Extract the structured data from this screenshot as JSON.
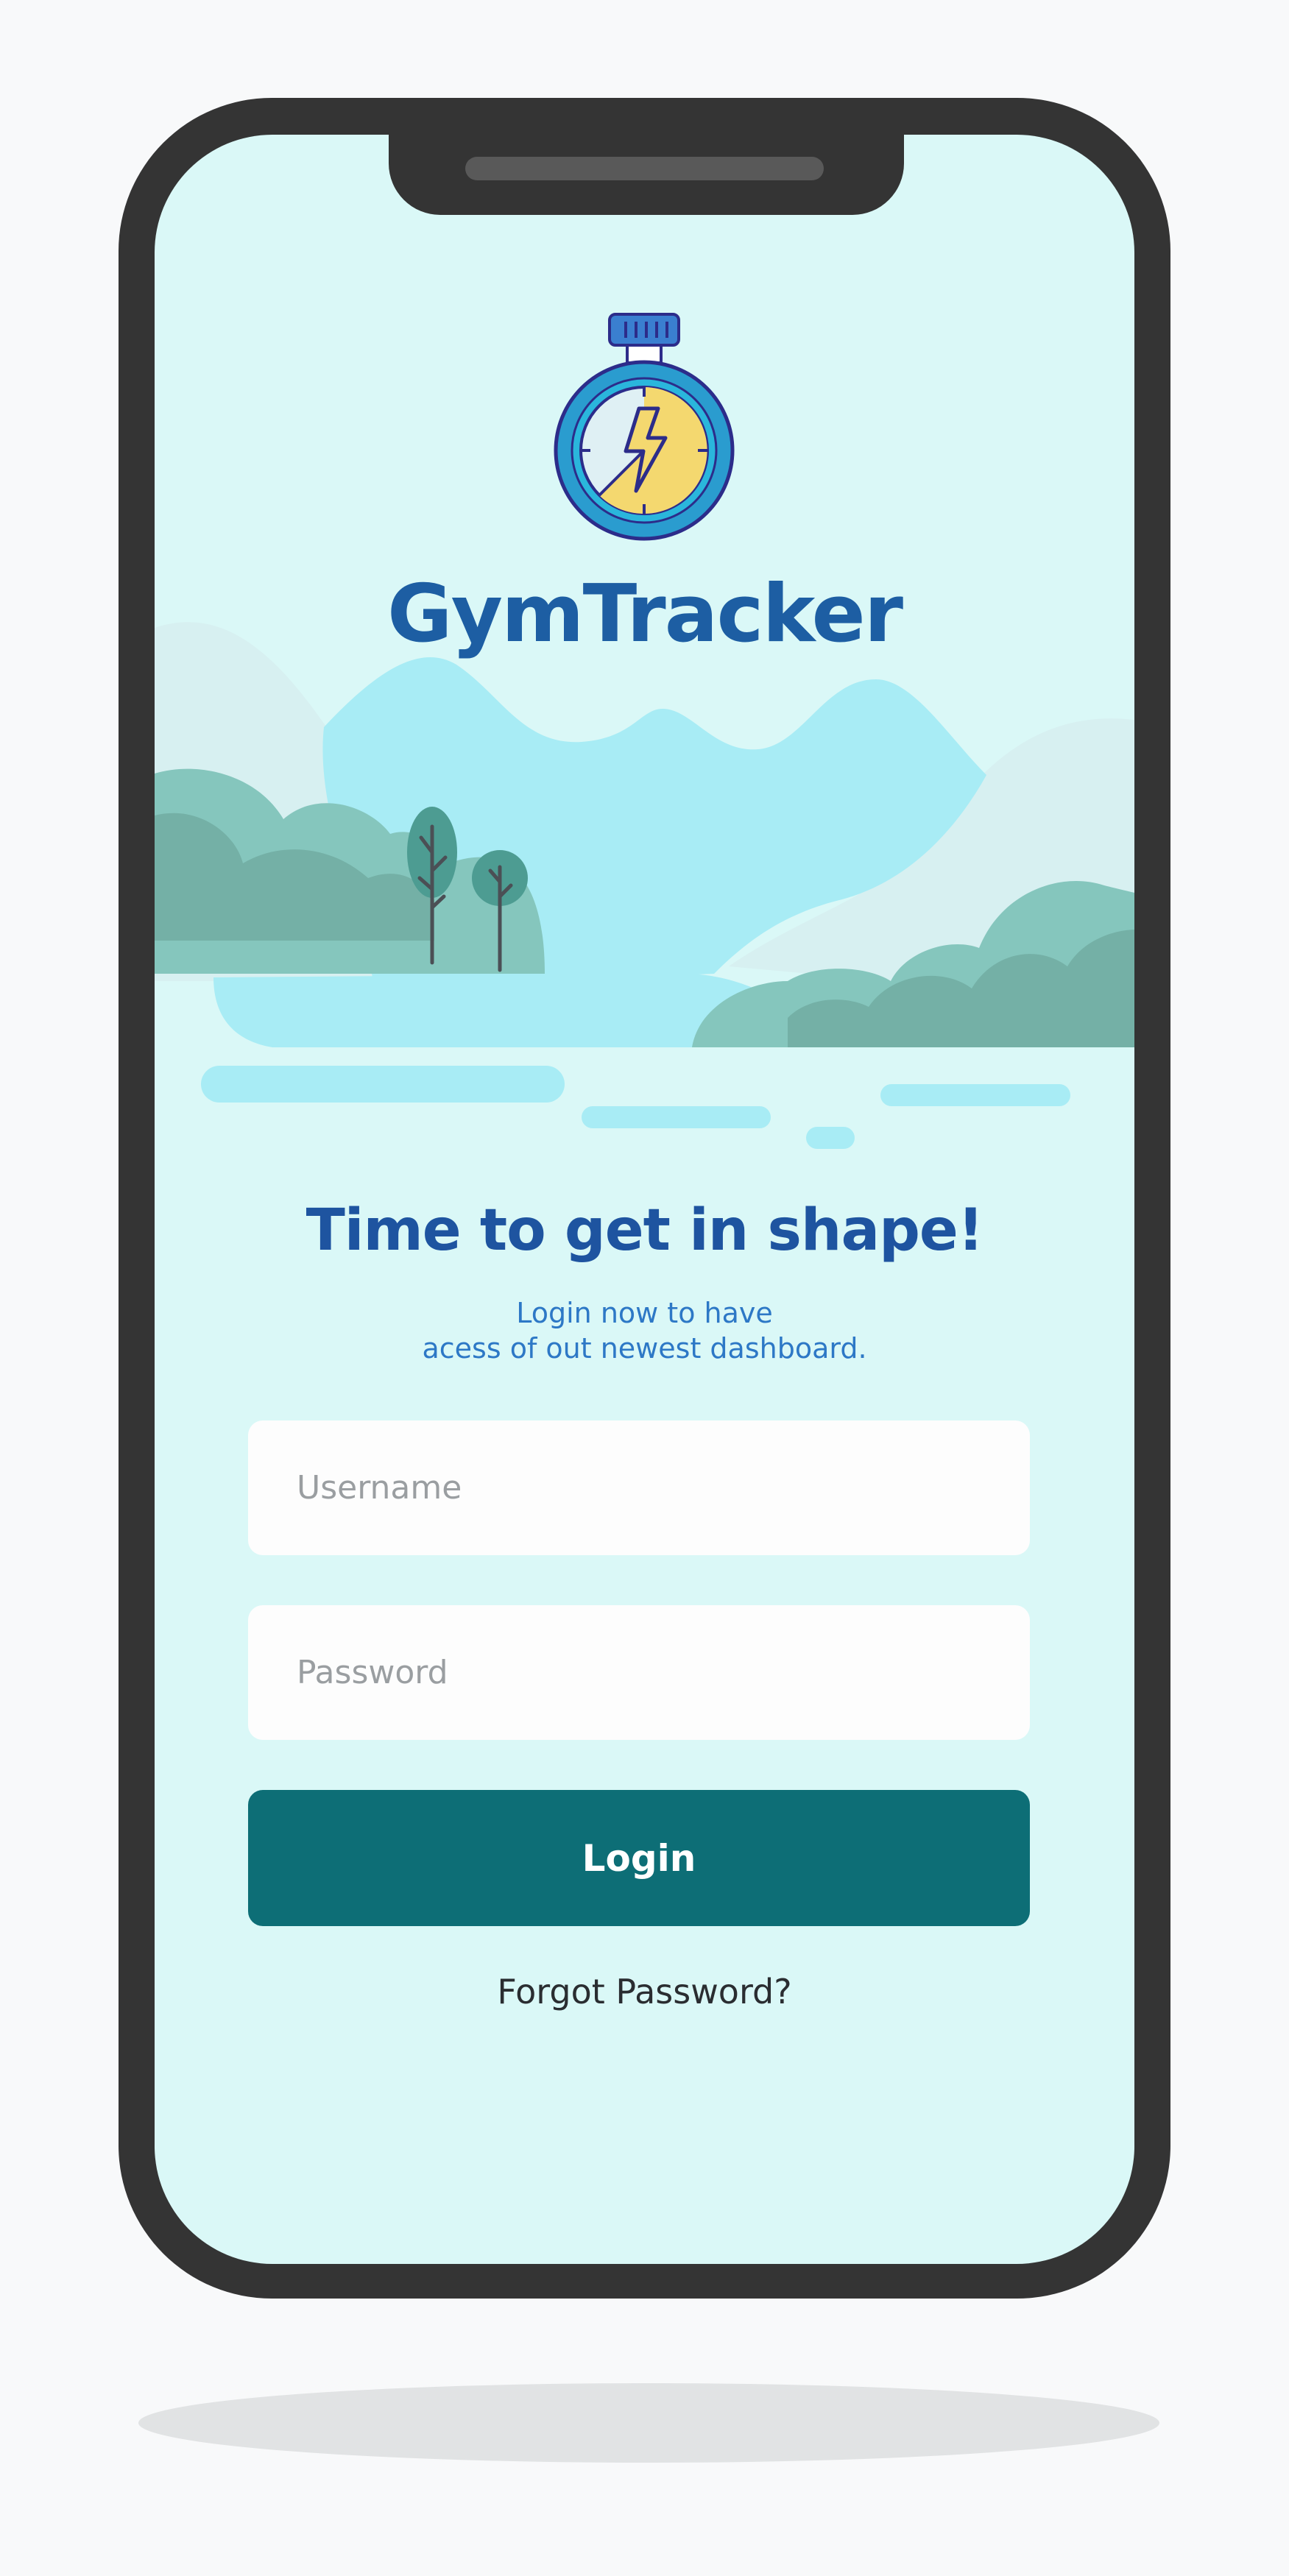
{
  "app": {
    "name": "GymTracker"
  },
  "login": {
    "headline": "Time to get in shape!",
    "subtext_line1": "Login now to have",
    "subtext_line2": "acess of out newest dashboard.",
    "username_placeholder": "Username",
    "password_placeholder": "Password",
    "login_label": "Login",
    "forgot_label": "Forgot Password?"
  },
  "icons": {
    "logo": "stopwatch-lightning-icon"
  },
  "colors": {
    "brand": "#1d5ea3",
    "headline": "#1e54a0",
    "subtext": "#2d78c6",
    "button": "#0d6e76",
    "screen_background": "#daf8f7",
    "phone_frame": "#343434"
  }
}
